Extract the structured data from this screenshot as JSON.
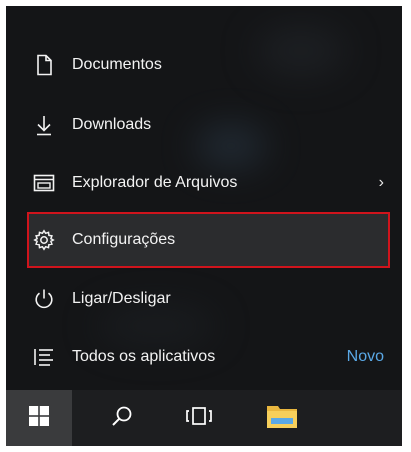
{
  "start_menu": {
    "items": [
      {
        "label": "Documentos",
        "icon": "document-icon"
      },
      {
        "label": "Downloads",
        "icon": "download-icon"
      },
      {
        "label": "Explorador de Arquivos",
        "icon": "file-explorer-icon",
        "trailing": "›"
      },
      {
        "label": "Configurações",
        "icon": "settings-gear-icon",
        "selected": true
      },
      {
        "label": "Ligar/Desligar",
        "icon": "power-icon"
      },
      {
        "label": "Todos os aplicativos",
        "icon": "all-apps-list-icon",
        "badge": "Novo"
      }
    ]
  },
  "taskbar": {
    "buttons": [
      {
        "icon": "windows-start-icon"
      },
      {
        "icon": "search-icon"
      },
      {
        "icon": "task-view-icon"
      },
      {
        "icon": "file-explorer-folder-icon"
      }
    ]
  },
  "colors": {
    "menu_background": "#141517",
    "taskbar_background": "#1d1e20",
    "highlight_border": "#d0141c",
    "accent_text": "#5aa8e6"
  }
}
